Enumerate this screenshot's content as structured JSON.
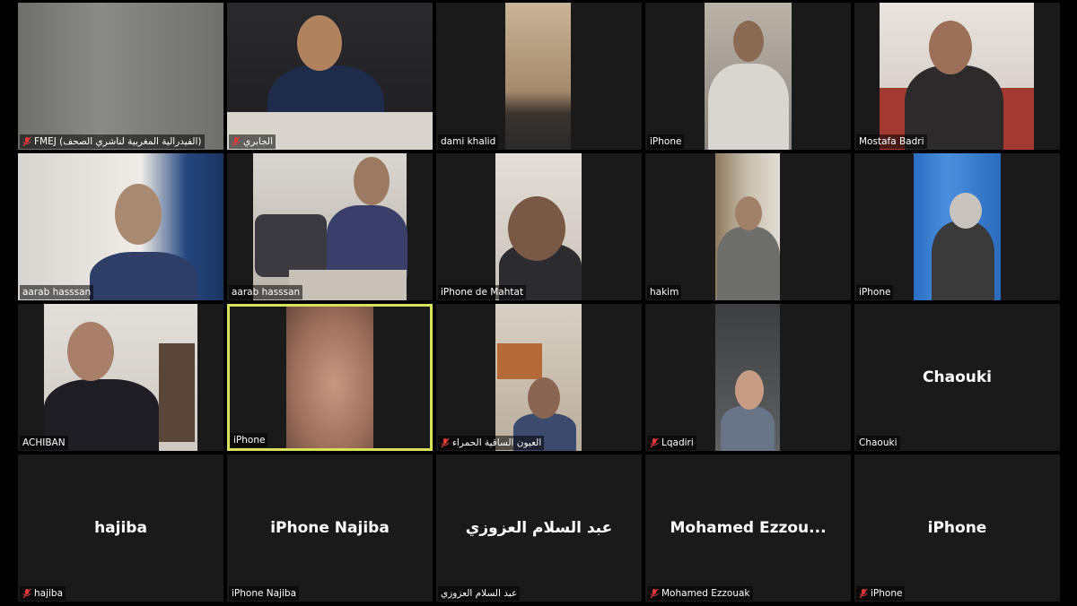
{
  "app": {
    "name": "Video conference gallery view"
  },
  "colors": {
    "background": "#000000",
    "tile": "#1a1a1a",
    "active_speaker": "#d8e25a",
    "mute": "#e03a3a"
  },
  "participants": [
    {
      "name": "FMEJ (الفيدرالية المغربية لناشري الصحف)",
      "muted": true
    },
    {
      "name": "الجابري",
      "muted": true
    },
    {
      "name": "dami khalid",
      "muted": false
    },
    {
      "name": "iPhone",
      "muted": false
    },
    {
      "name": "Mostafa Badri",
      "muted": false
    },
    {
      "name": "aarab hasssan",
      "muted": false
    },
    {
      "name": "aarab hasssan",
      "muted": false
    },
    {
      "name": "iPhone de Mahtat",
      "muted": false
    },
    {
      "name": "hakim",
      "muted": false
    },
    {
      "name": "iPhone",
      "muted": false
    },
    {
      "name": "ACHIBAN",
      "muted": false
    },
    {
      "name": "iPhone",
      "muted": false,
      "active_speaker": true
    },
    {
      "name": "العيون الساقية الحمراء",
      "muted": true
    },
    {
      "name": "Lqadiri",
      "muted": true
    },
    {
      "name": "Chaouki",
      "muted": false,
      "display": "Chaouki"
    },
    {
      "name": "hajiba",
      "muted": true,
      "display": "hajiba"
    },
    {
      "name": "iPhone Najiba",
      "muted": false,
      "display": "iPhone Najiba"
    },
    {
      "name": "عبد السلام العزوزي",
      "muted": false,
      "display": "عبد السلام العزوزي"
    },
    {
      "name": "Mohamed Ezzouak",
      "muted": true,
      "display": "Mohamed  Ezzou..."
    },
    {
      "name": "iPhone",
      "muted": true,
      "display": "iPhone"
    }
  ]
}
